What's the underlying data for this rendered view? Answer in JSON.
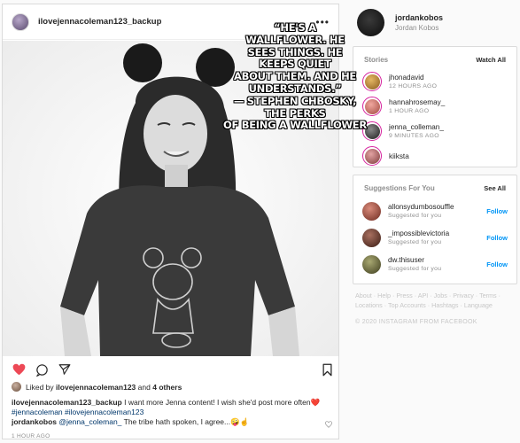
{
  "post": {
    "username": "ilovejennacoleman123_backup",
    "more": "...",
    "quote": "“HE'S A\nWALLFLOWER. HE\nSEES THINGS. HE\nKEEPS QUIET\nABOUT THEM. AND HE\nUNDERSTANDS.”\n— STEPHEN CHBOSKY,\nTHE PERKS\nOF BEING A WALLFLOWER",
    "likes": {
      "prefix": "Liked by",
      "user": "ilovejennacoleman123",
      "and": "and",
      "others": "4 others"
    },
    "caption": {
      "user": "ilovejennacoleman123_backup",
      "text": "I want more Jenna content! I wish she'd post more often❤️",
      "hashtags": "#jennacoleman #ilovejennacoleman123"
    },
    "comment": {
      "user": "jordankobos",
      "mention": "@jenna_coleman_",
      "text": "The tribe hath spoken, I agree...🤪☝️"
    },
    "time": "1 HOUR AGO"
  },
  "sidebar": {
    "me": {
      "username": "jordankobos",
      "name": "Jordan Kobos"
    },
    "stories": {
      "title": "Stories",
      "link": "Watch All",
      "items": [
        {
          "user": "jhonadavid",
          "time": "12 HOURS AGO",
          "color": "#c58a2e"
        },
        {
          "user": "hannahrosemay_",
          "time": "1 HOUR AGO",
          "color": "#d8736a"
        },
        {
          "user": "jenna_colleman_",
          "time": "9 MINUTES AGO",
          "color": "#3b3b3b"
        },
        {
          "user": "kiiksta",
          "time": "",
          "color": "#b56b6b"
        }
      ]
    },
    "suggestions": {
      "title": "Suggestions For You",
      "link": "See All",
      "items": [
        {
          "user": "allonsydumbosouffle",
          "sub": "Suggested for you",
          "action": "Follow",
          "color": "#9b4a3b"
        },
        {
          "user": "_impossiblevictoria",
          "sub": "Suggested for you",
          "action": "Follow",
          "color": "#6e4033"
        },
        {
          "user": "dw.thisuser",
          "sub": "Suggested for you",
          "action": "Follow",
          "color": "#6b6a3e"
        }
      ]
    },
    "footer": {
      "links": "About · Help · Press · API · Jobs · Privacy · Terms · Locations · Top Accounts · Hashtags · Language",
      "copyright": "© 2020 INSTAGRAM FROM FACEBOOK"
    }
  },
  "colors": {
    "accent": "#0095f6",
    "like": "#ed4956",
    "border": "#dbdbdb",
    "muted": "#8e8e8e"
  },
  "icons": [
    "more-icon",
    "heart-icon",
    "comment-icon",
    "share-icon",
    "bookmark-icon"
  ]
}
